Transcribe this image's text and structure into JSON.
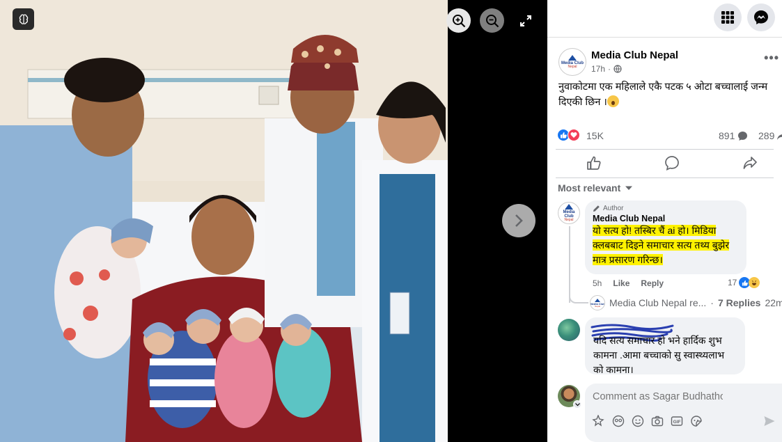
{
  "viewer": {
    "ai_badge_icon": "brain-icon",
    "zoom_in_icon": "zoom-in-icon",
    "zoom_out_icon": "zoom-out-icon",
    "fullscreen_icon": "fullscreen-icon",
    "next_icon": "chevron-right-icon"
  },
  "topbar": {
    "menu_icon": "grid-menu-icon",
    "messenger_icon": "messenger-icon"
  },
  "post": {
    "page_name": "Media Club Nepal",
    "time": "17h",
    "separator": "·",
    "privacy_icon": "globe-icon",
    "more": "•••",
    "caption": "नुवाकोटमा एक महिलाले एकै पटक ५ ओटा बच्चालाई जन्म दिएकी छिन ।",
    "caption_emoji": "astonished-emoji",
    "avatar_logo_line1": "Media Club",
    "avatar_logo_line2": "Nepal",
    "reaction_count": "15K",
    "comment_count": "891",
    "share_count": "289"
  },
  "actions": {
    "like_icon": "thumbs-up-icon",
    "comment_icon": "comment-icon",
    "share_icon": "share-icon"
  },
  "comments": {
    "sort_label": "Most relevant",
    "first": {
      "author_tag": "Author",
      "name": "Media Club Nepal",
      "text": "यो सत्य हो! तस्बिर चैं ai हो। मिडिया क्लबबाट दिइने समाचार सत्य तथ्य बुझेर मात्र प्रसारण गरिन्छ।",
      "time": "5h",
      "like": "Like",
      "reply": "Reply",
      "reactions": "17"
    },
    "replies": {
      "name": "Media Club Nepal re...",
      "separator": "·",
      "count": "7 Replies",
      "time": "22m"
    },
    "second": {
      "text": "यदि सत्य समाचार हो भने हार्दिक शुभ कामना .आमा बच्चाको सु स्वास्थ्यलाभ को कामना।"
    }
  },
  "compose": {
    "placeholder": "Comment as Sagar Budhathoki"
  },
  "colors": {
    "facebook_blue": "#1877f2",
    "love_red": "#f33e58",
    "highlight_yellow": "#fff200",
    "bubble_gray": "#f0f2f5"
  }
}
